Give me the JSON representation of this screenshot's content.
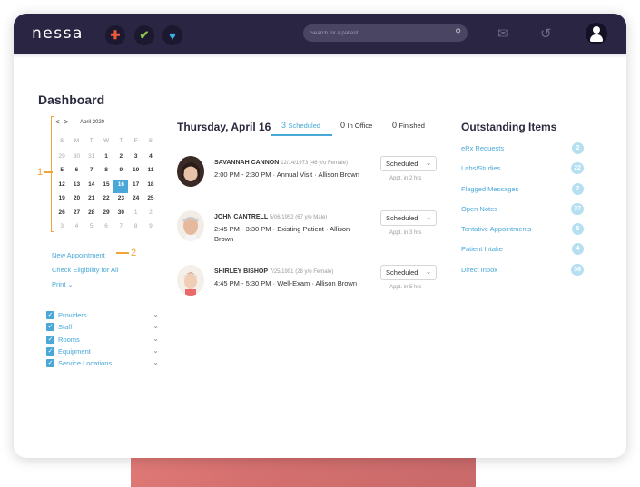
{
  "app": {
    "logo": "nessa"
  },
  "topbar": {
    "app_icons": [
      "plus-app-icon",
      "check-app-icon",
      "heart-app-icon"
    ],
    "search_placeholder": "Search for a patient..."
  },
  "colors": {
    "accent": "#4aa8d8",
    "topbar": "#2a2542",
    "marker": "#f2a33a",
    "badge": "#b6e0f2"
  },
  "dashboard": {
    "title": "Dashboard"
  },
  "calendar": {
    "month_label": "April 2020",
    "days_of_week": [
      "S",
      "M",
      "T",
      "W",
      "T",
      "F",
      "S"
    ],
    "weeks": [
      [
        {
          "d": "29",
          "m": 1
        },
        {
          "d": "30",
          "m": 1
        },
        {
          "d": "31",
          "m": 1
        },
        {
          "d": "1"
        },
        {
          "d": "2"
        },
        {
          "d": "3"
        },
        {
          "d": "4"
        }
      ],
      [
        {
          "d": "5"
        },
        {
          "d": "6"
        },
        {
          "d": "7"
        },
        {
          "d": "8"
        },
        {
          "d": "9"
        },
        {
          "d": "10"
        },
        {
          "d": "11"
        }
      ],
      [
        {
          "d": "12"
        },
        {
          "d": "13"
        },
        {
          "d": "14"
        },
        {
          "d": "15"
        },
        {
          "d": "16",
          "t": 1
        },
        {
          "d": "17"
        },
        {
          "d": "18"
        }
      ],
      [
        {
          "d": "19"
        },
        {
          "d": "20"
        },
        {
          "d": "21"
        },
        {
          "d": "22"
        },
        {
          "d": "23"
        },
        {
          "d": "24"
        },
        {
          "d": "25"
        }
      ],
      [
        {
          "d": "26"
        },
        {
          "d": "27"
        },
        {
          "d": "28"
        },
        {
          "d": "29"
        },
        {
          "d": "30"
        },
        {
          "d": "1",
          "m": 1
        },
        {
          "d": "2",
          "m": 1
        }
      ],
      [
        {
          "d": "3",
          "m": 1
        },
        {
          "d": "4",
          "m": 1
        },
        {
          "d": "5",
          "m": 1
        },
        {
          "d": "6",
          "m": 1
        },
        {
          "d": "7",
          "m": 1
        },
        {
          "d": "8",
          "m": 1
        },
        {
          "d": "9",
          "m": 1
        }
      ]
    ]
  },
  "markers": {
    "one": "1",
    "two": "2"
  },
  "actions": {
    "new_appointment": "New Appointment",
    "check_eligibility": "Check Eligibility for All",
    "print": "Print"
  },
  "filters": [
    "Providers",
    "Staff",
    "Rooms",
    "Equipment",
    "Service Locations"
  ],
  "schedule": {
    "date_title": "Thursday, April 16",
    "tabs": [
      {
        "count": "3",
        "label": "Scheduled"
      },
      {
        "count": "0",
        "label": "In Office"
      },
      {
        "count": "0",
        "label": "Finished"
      }
    ],
    "appointments": [
      {
        "name": "SAVANNAH CANNON",
        "meta": "12/14/1973 (46 y/o Female)",
        "time": "2:00 PM - 2:30 PM · Annual Visit · Allison Brown",
        "status": "Scheduled",
        "eta": "Appt. in 2 hrs"
      },
      {
        "name": "JOHN CANTRELL",
        "meta": "5/06/1952 (67 y/o Male)",
        "time": "2:45 PM - 3:30 PM · Existing Patient · Allison Brown",
        "status": "Scheduled",
        "eta": "Appt. in 3 hrs"
      },
      {
        "name": "SHIRLEY BISHOP",
        "meta": "7/25/1991 (28 y/o Female)",
        "time": "4:45 PM - 5:30 PM · Well-Exam · Allison Brown",
        "status": "Scheduled",
        "eta": "Appt. in 5 hrs"
      }
    ]
  },
  "outstanding": {
    "title": "Outstanding Items",
    "items": [
      {
        "label": "eRx Requests",
        "count": "2"
      },
      {
        "label": "Labs/Studies",
        "count": "22"
      },
      {
        "label": "Flagged Messages",
        "count": "2"
      },
      {
        "label": "Open Notes",
        "count": "37"
      },
      {
        "label": "Tentative Appointments",
        "count": "5"
      },
      {
        "label": "Patient Intake",
        "count": "4"
      },
      {
        "label": "Direct Inbox",
        "count": "36"
      }
    ]
  }
}
